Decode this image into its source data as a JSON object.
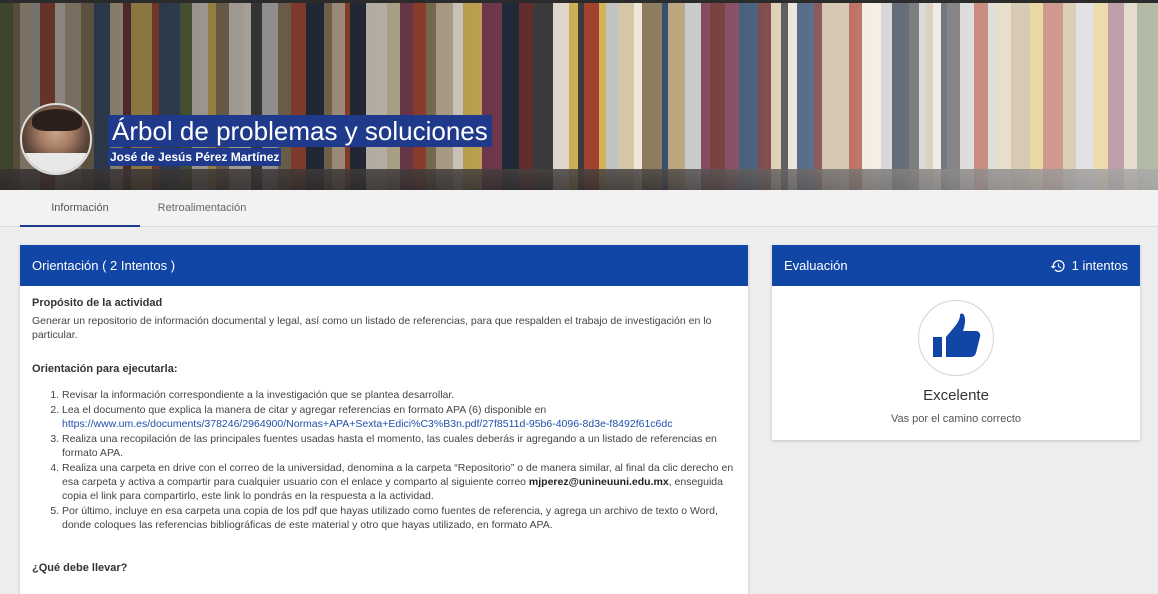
{
  "header": {
    "title": "Árbol de problemas y soluciones",
    "author": "José de Jesús Pérez Martínez"
  },
  "tabs": [
    {
      "label": "Información",
      "active": true
    },
    {
      "label": "Retroalimentación",
      "active": false
    }
  ],
  "orientation": {
    "title": "Orientación ( 2 Intentos )",
    "purpose_heading": "Propósito de la actividad",
    "purpose_text": "Generar un repositorio de información documental y legal, así como un listado de referencias, para que respalden el trabajo de investigación en lo particular.",
    "howto_heading": "Orientación para ejecutarla:",
    "steps": {
      "s1": "Revisar la información correspondiente a la investigación que se plantea desarrollar.",
      "s2_text": "Lea el documento que explica la manera de citar y agregar referencias en formato APA (6) disponible en ",
      "s2_link": "https://www.um.es/documents/378246/2964900/Normas+APA+Sexta+Edici%C3%B3n.pdf/27f8511d-95b6-4096-8d3e-f8492f61c6dc",
      "s3": "Realiza una recopilación de las principales fuentes usadas hasta el momento, las cuales deberás ir agregando a un listado de referencias en formato APA.",
      "s4_text": "Realiza una carpeta en drive con el correo de la universidad, denomina a la carpeta “Repositorio” o de manera similar, al final da clic derecho en esa carpeta y activa a compartir para cualquier usuario con el enlace y comparto al siguiente correo ",
      "s4_email": "mjperez@unineuuni.edu.mx",
      "s4_tail": ", enseguida copia el link para compartirlo, este link lo pondrás en la respuesta a la actividad.",
      "s5": "Por último, incluye en esa carpeta una copia de los pdf que hayas utilizado como fuentes de referencia, y agrega un archivo de texto o Word, donde coloques las referencias bibliográficas de este material y otro que hayas utilizado, en formato APA."
    },
    "next_heading": "¿Qué debe llevar?"
  },
  "evaluation": {
    "title": "Evaluación",
    "attempts": "1 intentos",
    "attempts_icon": "history-icon",
    "result_icon": "thumbs-up-icon",
    "label": "Excelente",
    "sub": "Vas por el camino correcto"
  },
  "colors": {
    "primary": "#1246a6",
    "highlight": "#1f3a8a",
    "link": "#1f4fa8"
  }
}
